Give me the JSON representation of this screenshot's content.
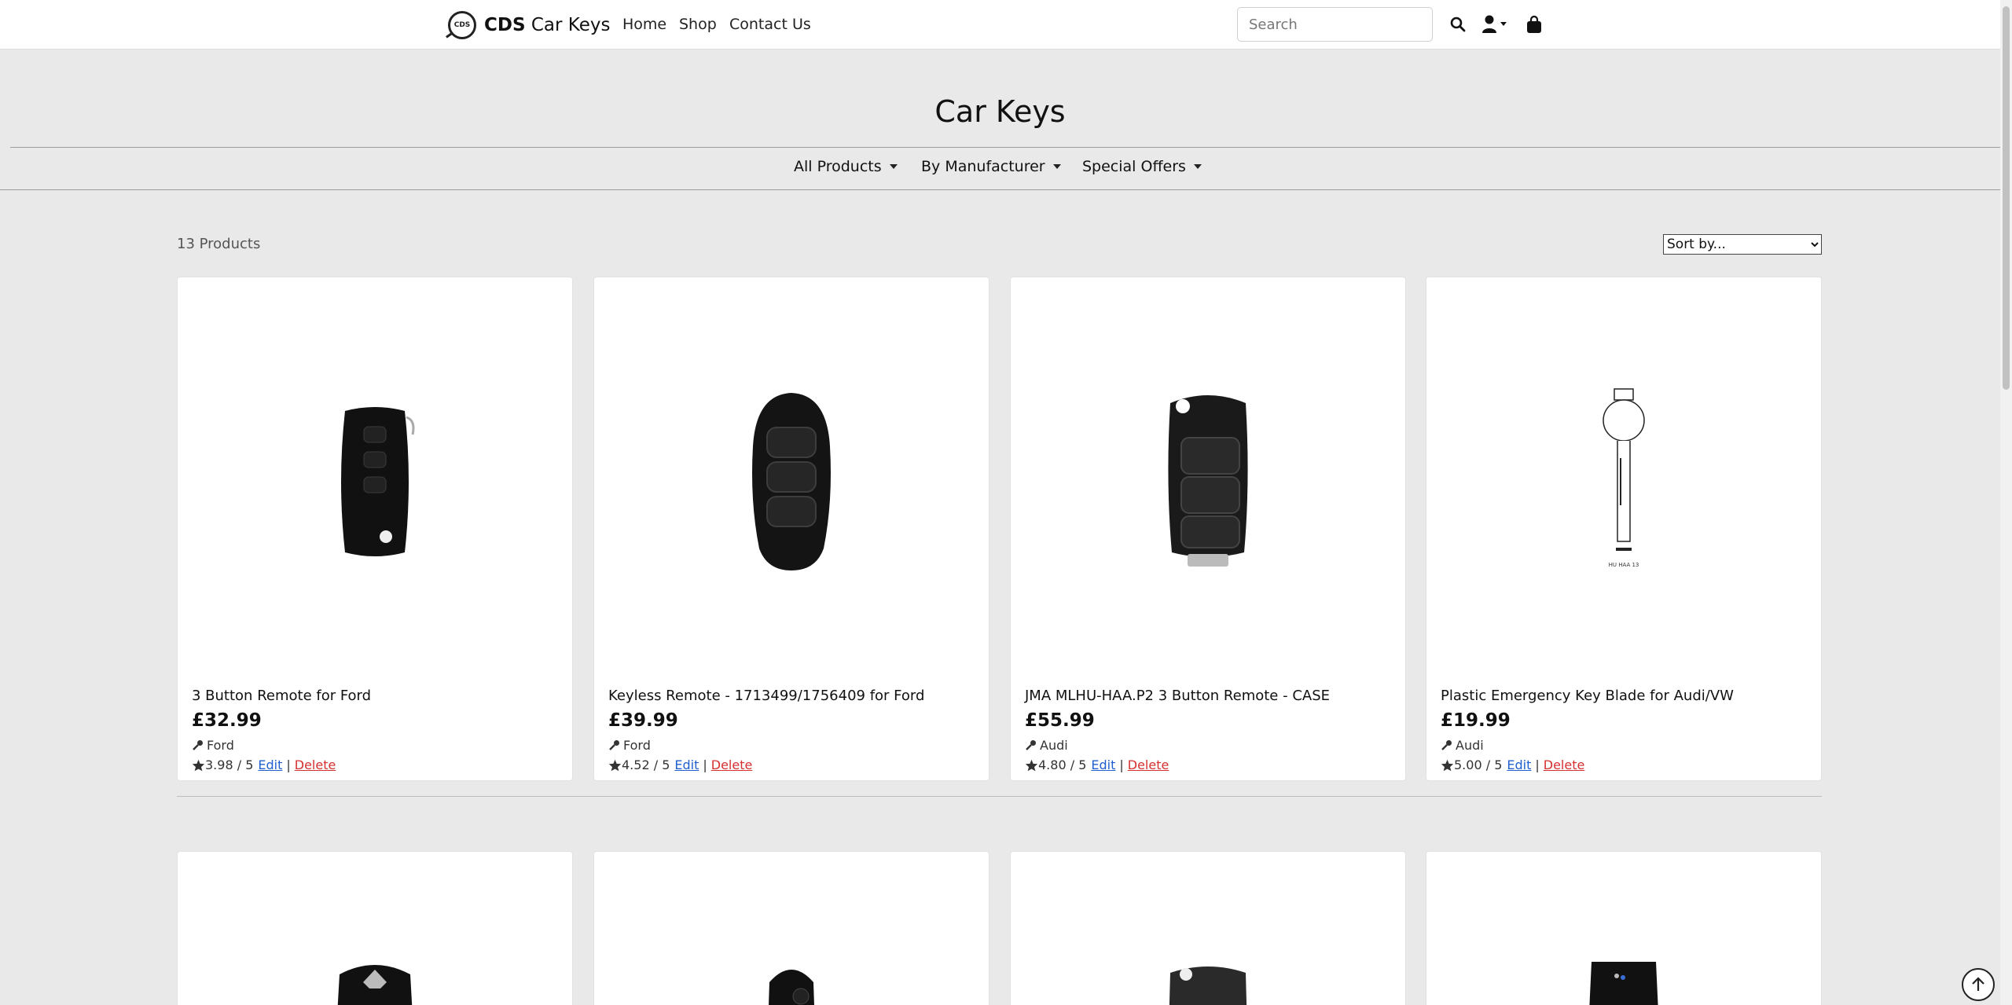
{
  "header": {
    "brand_logo_text": "CDS",
    "brand_bold": "CDS",
    "brand_rest": " Car Keys",
    "nav": {
      "home": "Home",
      "shop": "Shop",
      "contact": "Contact Us"
    },
    "search_placeholder": "Search",
    "icons": [
      "search-icon",
      "user-icon",
      "shopping-bag-icon"
    ]
  },
  "page": {
    "title": "Car Keys",
    "categories": {
      "all": "All Products",
      "manufacturer": "By Manufacturer",
      "offers": "Special Offers"
    }
  },
  "listing": {
    "count": "13 Products",
    "sort_label": "Sort by...",
    "edit_label": "Edit",
    "delete_label": "Delete",
    "separator": "|",
    "products": [
      {
        "name": "3 Button Remote for Ford",
        "price": "£32.99",
        "manufacturer": "Ford",
        "rating": "3.98 / 5"
      },
      {
        "name": "Keyless Remote - 1713499/1756409 for Ford",
        "price": "£39.99",
        "manufacturer": "Ford",
        "rating": "4.52 / 5"
      },
      {
        "name": "JMA MLHU-HAA.P2 3 Button Remote - CASE",
        "price": "£55.99",
        "manufacturer": "Audi",
        "rating": "4.80 / 5"
      },
      {
        "name": "Plastic Emergency Key Blade for Audi/VW",
        "price": "£19.99",
        "manufacturer": "Audi",
        "rating": "5.00 / 5"
      }
    ],
    "blade_text": "HU HAA 13"
  },
  "colors": {
    "link": "#1f5fd0",
    "delete": "#d62f2f",
    "background": "#e9e9e9"
  }
}
